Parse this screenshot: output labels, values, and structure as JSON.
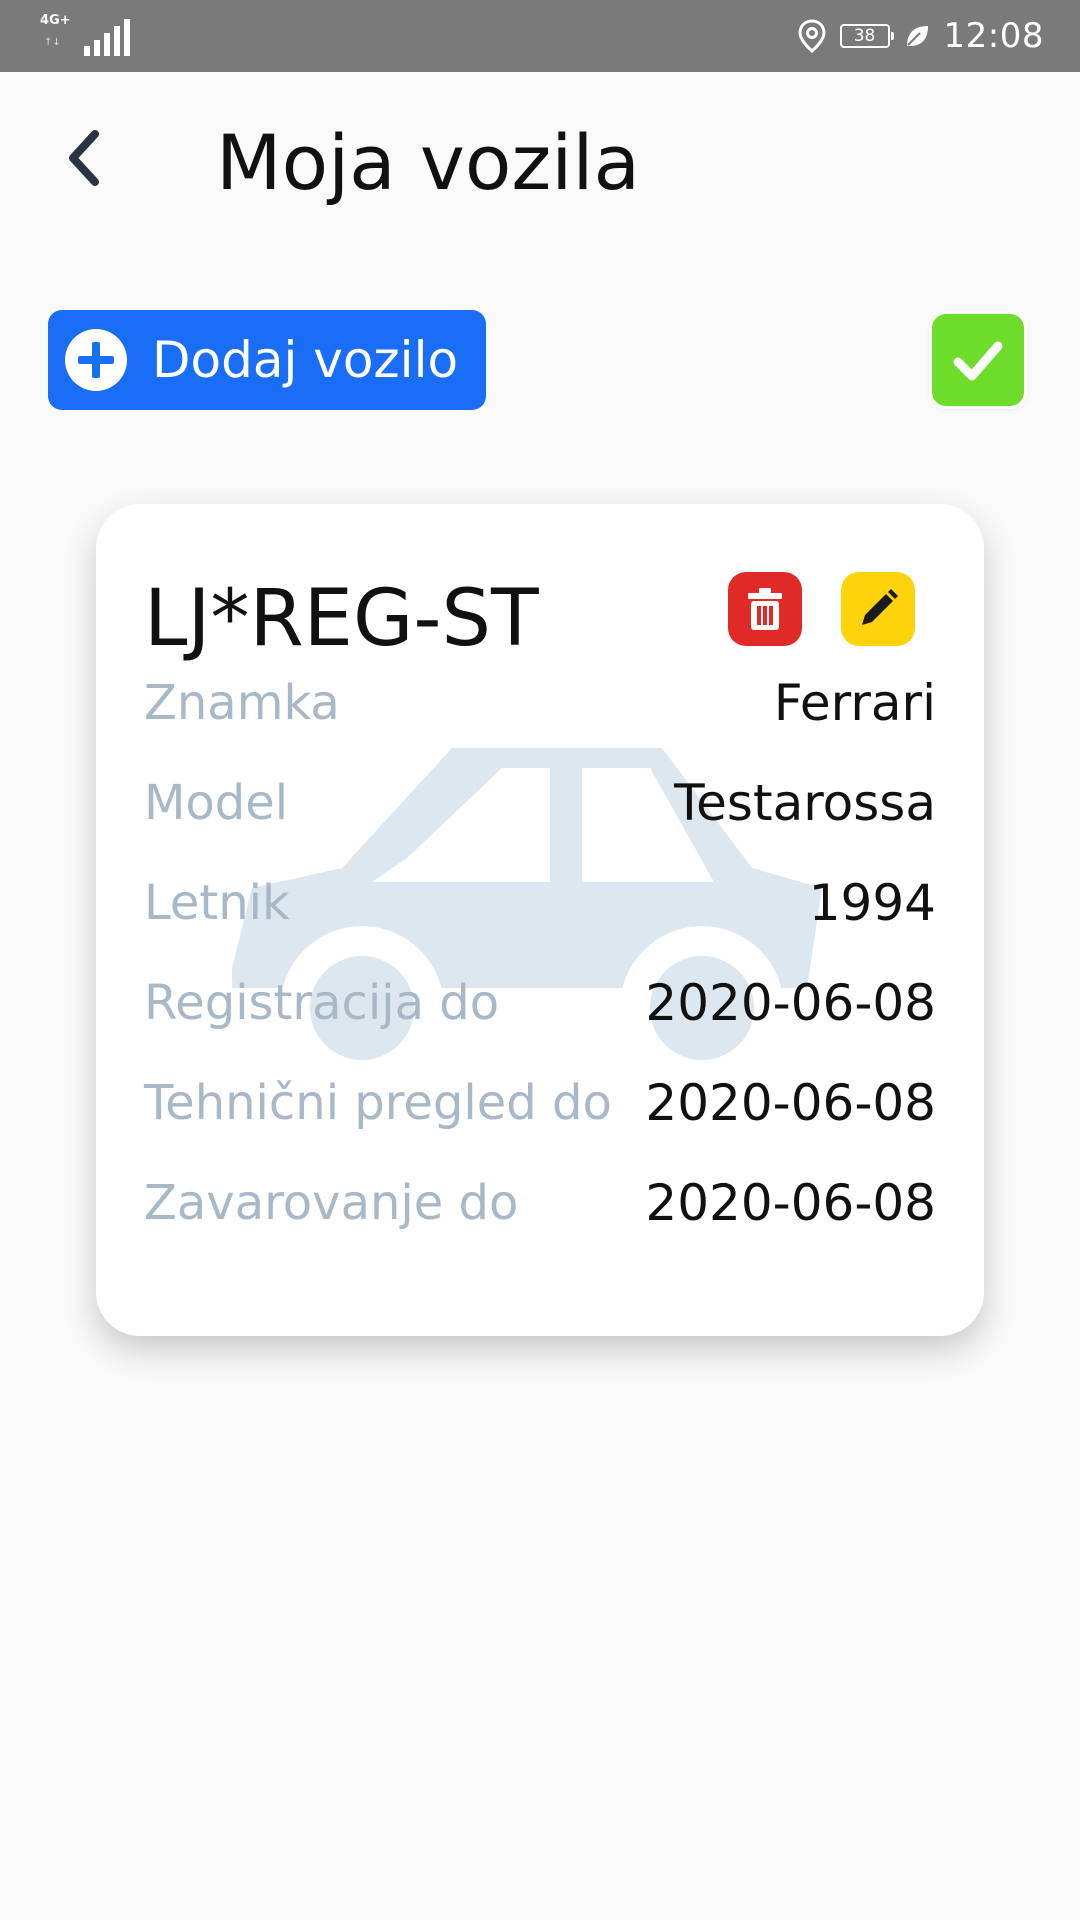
{
  "status_bar": {
    "network": "4G+",
    "battery": "38",
    "time": "12:08"
  },
  "header": {
    "title": "Moja vozila"
  },
  "actions": {
    "add_vehicle_label": "Dodaj vozilo"
  },
  "vehicle": {
    "plate": "LJ*REG-ST",
    "rows": [
      {
        "label": "Znamka",
        "value": "Ferrari"
      },
      {
        "label": "Model",
        "value": "Testarossa"
      },
      {
        "label": "Letnik",
        "value": "1994"
      },
      {
        "label": "Registracija do",
        "value": "2020-06-08"
      },
      {
        "label": "Tehnični pregled do",
        "value": "2020-06-08"
      },
      {
        "label": "Zavarovanje do",
        "value": "2020-06-08"
      }
    ]
  },
  "colors": {
    "primary": "#1a6ef5",
    "confirm": "#6ddc2a",
    "delete": "#e02a27",
    "edit": "#fed30c",
    "label": "#a9b8c6",
    "car_watermark": "#dde7ef"
  }
}
